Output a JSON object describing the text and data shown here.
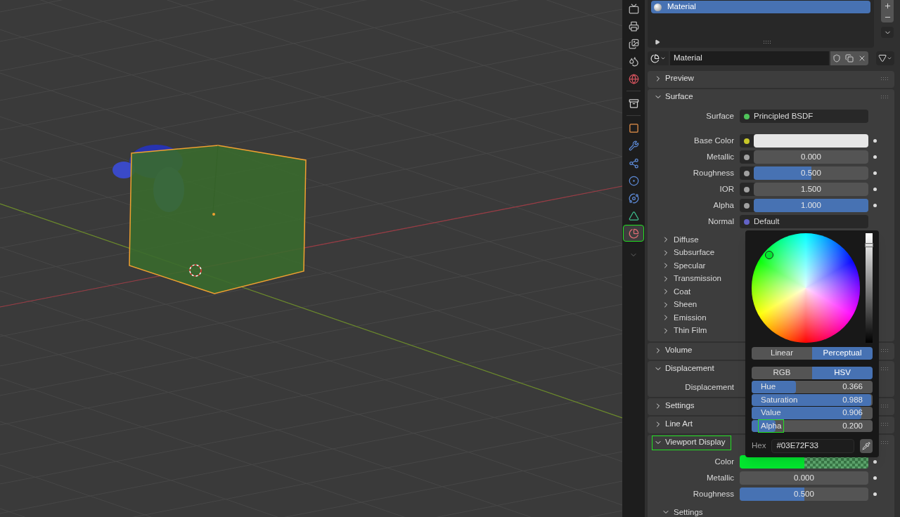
{
  "tabs": [
    {
      "kind": "render",
      "selected": false,
      "highlighted": false
    },
    {
      "kind": "output",
      "selected": false,
      "highlighted": false
    },
    {
      "kind": "view_layer",
      "selected": false,
      "highlighted": false
    },
    {
      "kind": "scene",
      "selected": false,
      "highlighted": false
    },
    {
      "kind": "world",
      "selected": false,
      "highlighted": false
    },
    {
      "kind": "collection",
      "selected": false,
      "highlighted": false
    },
    {
      "kind": "object",
      "selected": false,
      "highlighted": false
    },
    {
      "kind": "modifiers",
      "selected": false,
      "highlighted": false
    },
    {
      "kind": "particles",
      "selected": false,
      "highlighted": false
    },
    {
      "kind": "physics",
      "selected": false,
      "highlighted": false
    },
    {
      "kind": "constraints",
      "selected": false,
      "highlighted": false
    },
    {
      "kind": "data",
      "selected": false,
      "highlighted": false
    },
    {
      "kind": "material",
      "selected": true,
      "highlighted": true
    }
  ],
  "material_slots": {
    "items": [
      {
        "name": "Material",
        "selected": true
      }
    ]
  },
  "material_selector": {
    "name": "Material"
  },
  "panels": [
    {
      "title": "Preview",
      "expanded": false,
      "highlighted": false
    },
    {
      "title": "Surface",
      "expanded": true,
      "highlighted": false,
      "rows": [
        {
          "kind": "link",
          "label": "Surface",
          "value": "Principled BSDF",
          "socket": {
            "color": "#4fc35a"
          }
        },
        {
          "kind": "color",
          "label": "Base Color",
          "socket": {
            "color": "#c7c729"
          },
          "color": "#e6e6e6",
          "transparent": false
        },
        {
          "kind": "slider",
          "label": "Metallic",
          "socket": {
            "color": "#a1a1a1"
          },
          "value": "0.000",
          "level": 0
        },
        {
          "kind": "slider",
          "label": "Roughness",
          "socket": {
            "color": "#a1a1a1"
          },
          "value": "0.500",
          "level": 0.5
        },
        {
          "kind": "slider",
          "label": "IOR",
          "socket": {
            "color": "#a1a1a1"
          },
          "value": "1.500",
          "level": 0
        },
        {
          "kind": "slider",
          "label": "Alpha",
          "socket": {
            "color": "#a1a1a1"
          },
          "value": "1.000",
          "level": 1
        },
        {
          "kind": "link",
          "label": "Normal",
          "value": "Default",
          "socket": {
            "color": "#6363c7"
          }
        }
      ],
      "subpanels": [
        {
          "title": "Diffuse",
          "expanded": false
        },
        {
          "title": "Subsurface",
          "expanded": false
        },
        {
          "title": "Specular",
          "expanded": false
        },
        {
          "title": "Transmission",
          "expanded": false
        },
        {
          "title": "Coat",
          "expanded": false
        },
        {
          "title": "Sheen",
          "expanded": false
        },
        {
          "title": "Emission",
          "expanded": false
        },
        {
          "title": "Thin Film",
          "expanded": false
        }
      ]
    },
    {
      "title": "Volume",
      "expanded": false,
      "highlighted": false
    },
    {
      "title": "Displacement",
      "expanded": true,
      "highlighted": false,
      "rows": [
        {
          "kind": "label",
          "label": "Displacement"
        }
      ]
    },
    {
      "title": "Settings",
      "expanded": false,
      "highlighted": false
    },
    {
      "title": "Line Art",
      "expanded": false,
      "highlighted": false
    },
    {
      "title": "Viewport Display",
      "expanded": true,
      "highlighted": true,
      "rows": [
        {
          "kind": "color",
          "label": "Color",
          "color": "#03e72f",
          "transparent": true
        },
        {
          "kind": "slider",
          "label": "Metallic",
          "value": "0.000",
          "level": 0
        },
        {
          "kind": "slider",
          "label": "Roughness",
          "value": "0.500",
          "level": 0.5
        }
      ],
      "subpanels": [
        {
          "title": "Settings",
          "expanded": true
        }
      ]
    }
  ],
  "color_picker": {
    "modes": [
      {
        "label": "Linear",
        "selected": false
      },
      {
        "label": "Perceptual",
        "selected": true
      }
    ],
    "models": [
      {
        "label": "RGB",
        "selected": false
      },
      {
        "label": "HSV",
        "selected": true
      }
    ],
    "sliders": [
      {
        "label": "Hue",
        "value": "0.366",
        "level": 0.366,
        "highlighted": false
      },
      {
        "label": "Saturation",
        "value": "0.988",
        "level": 0.988,
        "highlighted": false
      },
      {
        "label": "Value",
        "value": "0.906",
        "level": 0.906,
        "highlighted": false
      },
      {
        "label": "Alpha",
        "value": "0.200",
        "level": 0.2,
        "highlighted": true
      }
    ],
    "value_bar": {
      "level": 0.906
    },
    "hex_label": "Hex",
    "hex_value": "#03E72F33"
  }
}
